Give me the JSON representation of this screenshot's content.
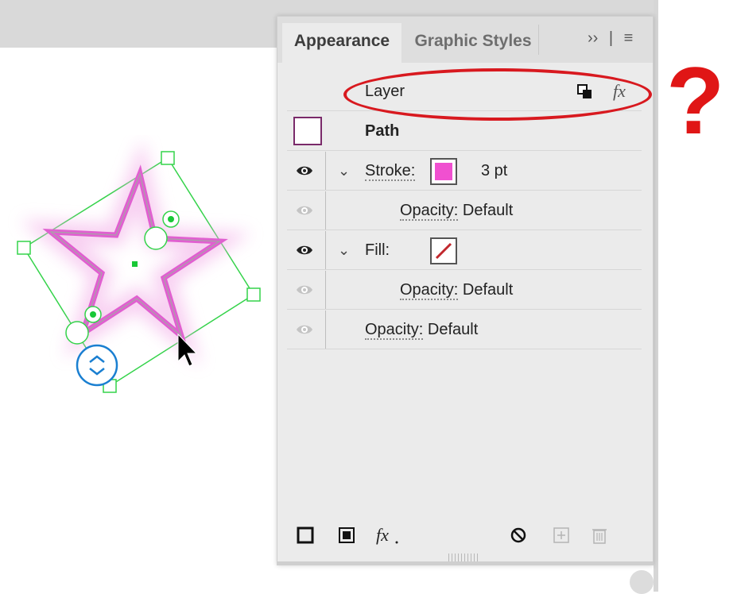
{
  "panel": {
    "tabs": [
      {
        "label": "Appearance",
        "active": true
      },
      {
        "label": "Graphic Styles",
        "active": false
      }
    ],
    "controls": {
      "expand": "››",
      "menu": "≡"
    }
  },
  "appearance": {
    "layer": {
      "label": "Layer"
    },
    "path": {
      "label": "Path"
    },
    "stroke": {
      "label": "Stroke:",
      "weight": "3 pt",
      "color": "#f050d0"
    },
    "stroke_opacity": {
      "label": "Opacity:",
      "value": "Default"
    },
    "fill": {
      "label": "Fill:",
      "color": "none"
    },
    "fill_opacity": {
      "label": "Opacity:",
      "value": "Default"
    },
    "opacity": {
      "label": "Opacity:",
      "value": "Default"
    }
  },
  "annotation": {
    "mark": "?",
    "color": "#e01616"
  },
  "colors": {
    "selection": "#34d34a",
    "star": "#e060d0",
    "rotate_handle": "#1a7fd1"
  },
  "icons": [
    "eye-icon",
    "chevron-down-icon",
    "duplicate-icon",
    "fx-icon",
    "add-stroke-icon",
    "add-fill-icon",
    "fx-menu-icon",
    "clear-icon",
    "duplicate-item-icon",
    "delete-icon",
    "rotate-icon"
  ]
}
